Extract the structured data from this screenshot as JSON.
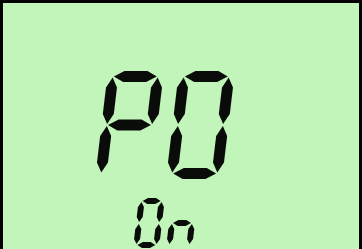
{
  "display": {
    "background_color": "#c2f5ba",
    "segment_color": "#0a0c0a",
    "parameter_code": "P0",
    "parameter_value": "0n"
  }
}
